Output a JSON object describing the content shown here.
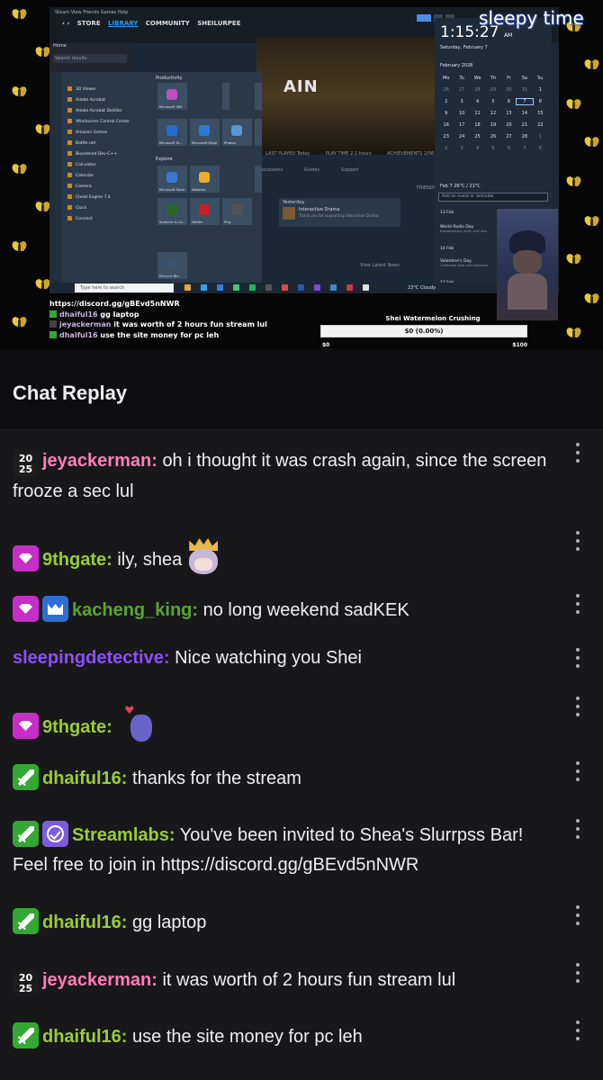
{
  "stream": {
    "overlay_title": "sleepy time",
    "steam": {
      "menu": "Steam  View  Friends  Games  Help",
      "nav": [
        "STORE",
        "LIBRARY",
        "COMMUNITY",
        "SHEILURPEE"
      ],
      "home": "Home",
      "search_results": "Search results",
      "game_title": "AIN",
      "stats": [
        "LAST PLAYED Today",
        "PLAY TIME 2.1 hours",
        "ACHIEVEMENTS 2/56"
      ],
      "tabs": [
        "Discussions",
        "Guides",
        "Support"
      ],
      "card_header": "Yesterday",
      "card_title": "Interactive Drama",
      "card_sub": "Thank you for supporting Interactive Drama",
      "latest": "View Latest News",
      "friends": "FRIENDS"
    },
    "startmenu": {
      "header": "Productivity",
      "explore": "Explore",
      "apps": [
        "3D Viewer",
        "Adobe Acrobat",
        "Adobe Acrobat Distiller",
        "Afterburner Control Center",
        "Amazon Games",
        "Battle.net",
        "Bloodshed Dev-C++",
        "Calculator",
        "Calendar",
        "Camera",
        "Cheat Engine 7.4",
        "Clock",
        "Connect"
      ],
      "tiles": [
        "Microsoft 365",
        "Microsoft Edge",
        "Photos",
        "Microsoft To...",
        "Microsoft Store",
        "Weather",
        "Solitaire & Ca...",
        "Netflix",
        "Play",
        "Recycle Bin"
      ]
    },
    "taskbar": {
      "search": "Type here to search",
      "weather": "23°C Cloudy"
    },
    "calendar": {
      "time": "1:15:27",
      "ampm": "AM",
      "date": "Saturday, February 7",
      "month": "February 2026",
      "weekdays": [
        "Mo",
        "Tu",
        "We",
        "Th",
        "Fr",
        "Sa",
        "Su"
      ],
      "weather_line": "Feb 7  26°C / 21°C",
      "add_event": "Add an event or reminder",
      "events": [
        {
          "day": "13 Feb",
          "title": "",
          "sub": ""
        },
        {
          "day": "",
          "title": "World Radio Day",
          "sub": "Broadcasting unity and inte"
        },
        {
          "day": "14 Feb",
          "title": "",
          "sub": ""
        },
        {
          "day": "",
          "title": "Valentine's Day",
          "sub": "Celebrate love and romance"
        },
        {
          "day": "17 Feb",
          "title": "",
          "sub": ""
        }
      ]
    },
    "overlay_chat": [
      {
        "user": "",
        "text": "https://discord.gg/gBEvd5nNWR"
      },
      {
        "user": "dhaiful16",
        "text": "gg laptop"
      },
      {
        "user": "jeyackerman",
        "text": "it was worth of 2 hours fun stream lul"
      },
      {
        "user": "dhaiful16",
        "text": "use the site money for pc leh"
      }
    ],
    "goal": {
      "title": "Shei Watermelon Crushing",
      "progress_text": "$0 (0.00%)",
      "progress": 0.0,
      "min": "$0",
      "max": "$100"
    }
  },
  "chat": {
    "title": "Chat Replay",
    "messages": [
      {
        "user": "jeyackerman",
        "color": "#ff7eb6",
        "badges": [
          "2025"
        ],
        "text": "oh i thought it was crash again, since the screen frooze a sec lul"
      },
      {
        "user": "9thgate",
        "color": "#9acd32",
        "badges": [
          "subscriber"
        ],
        "text": "ily, shea"
      },
      {
        "user": "kacheng_king",
        "color": "#5aa532",
        "badges": [
          "subscriber",
          "crown"
        ],
        "text": "no long weekend sadKEK"
      },
      {
        "user": "sleepingdetective",
        "color": "#8a4fff",
        "badges": [],
        "text": "Nice watching you Shei"
      },
      {
        "user": "9thgate",
        "color": "#9acd32",
        "badges": [
          "subscriber"
        ],
        "text": ""
      },
      {
        "user": "dhaiful16",
        "color": "#9acd32",
        "badges": [
          "sword"
        ],
        "text": "thanks for the stream"
      },
      {
        "user": "Streamlabs",
        "color": "#9acd32",
        "badges": [
          "sword",
          "verified"
        ],
        "text": "You've been invited to Shea's Slurrpss Bar! Feel free to join in https://discord.gg/gBEvd5nNWR"
      },
      {
        "user": "dhaiful16",
        "color": "#9acd32",
        "badges": [
          "sword"
        ],
        "text": "gg laptop"
      },
      {
        "user": "jeyackerman",
        "color": "#ff7eb6",
        "badges": [
          "2025"
        ],
        "text": "it was worth of 2 hours fun stream lul"
      },
      {
        "user": "dhaiful16",
        "color": "#9acd32",
        "badges": [
          "sword"
        ],
        "text": "use the site money for pc leh"
      }
    ]
  },
  "icons": {
    "more": "more-vertical-icon",
    "emote_queen": "queen-emote",
    "emote_heart": "finger-heart-emote"
  }
}
